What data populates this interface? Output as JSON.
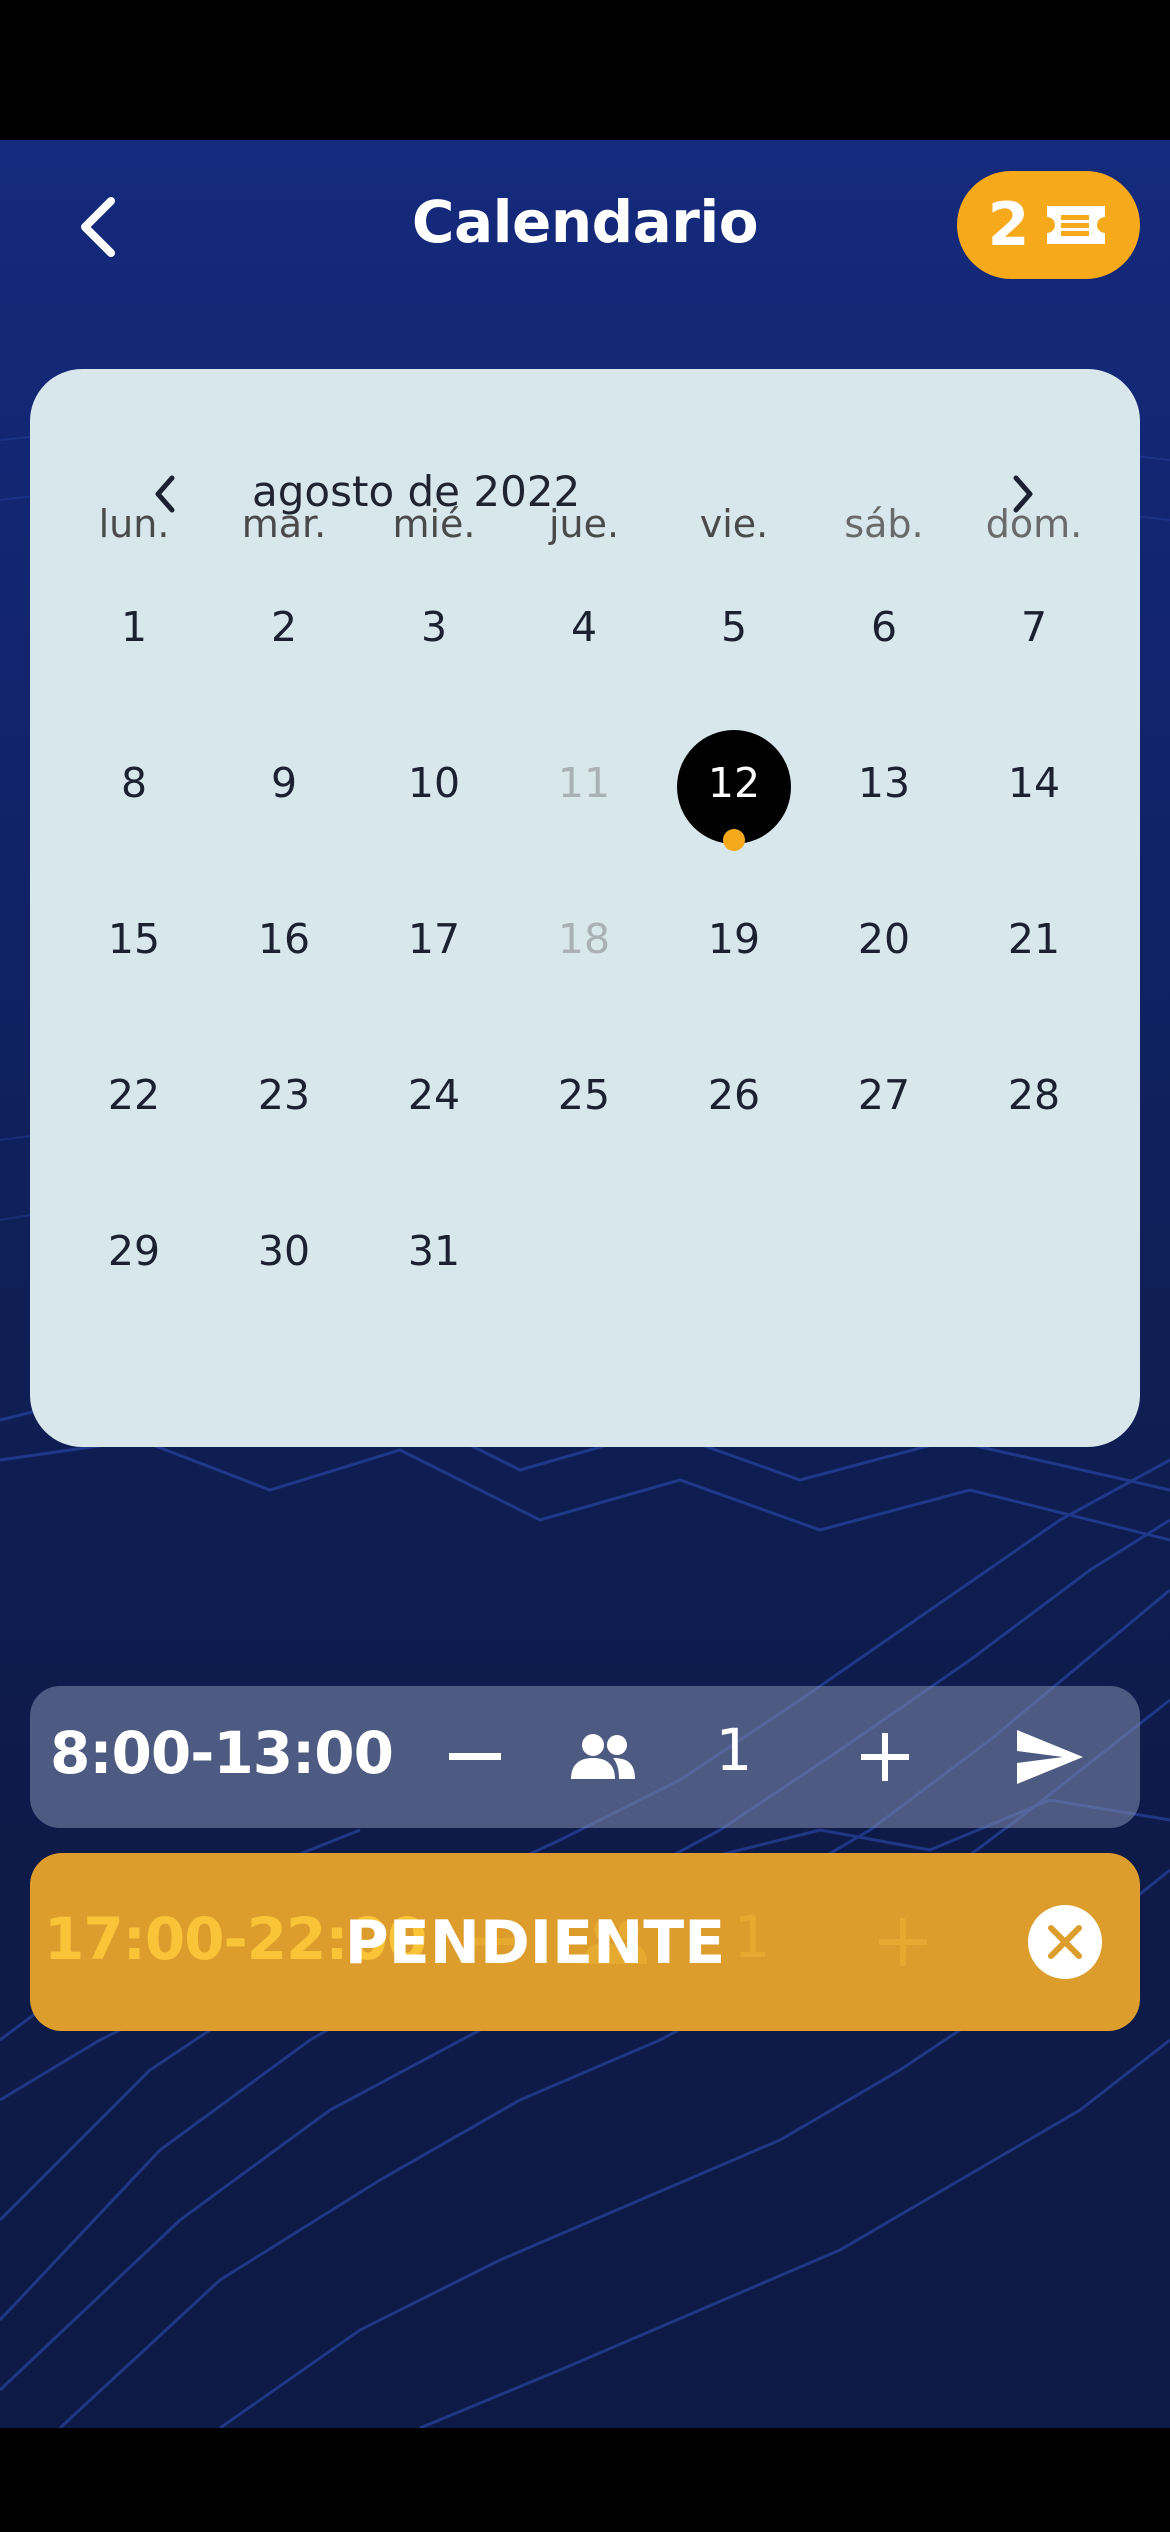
{
  "header": {
    "title": "Calendario",
    "tickets_count": "2"
  },
  "calendar": {
    "month_label": "agosto de 2022",
    "weekdays": [
      "lun.",
      "mar.",
      "mié.",
      "jue.",
      "vie.",
      "sáb.",
      "dom."
    ],
    "days": [
      [
        "1",
        "2",
        "3",
        "4",
        "5",
        "6",
        "7"
      ],
      [
        "8",
        "9",
        "10",
        "11",
        "12",
        "13",
        "14"
      ],
      [
        "15",
        "16",
        "17",
        "18",
        "19",
        "20",
        "21"
      ],
      [
        "22",
        "23",
        "24",
        "25",
        "26",
        "27",
        "28"
      ],
      [
        "29",
        "30",
        "31",
        "",
        "",
        "",
        ""
      ]
    ],
    "disabled_days": [
      "11",
      "18"
    ],
    "selected_day": "12",
    "marked_days": [
      "12"
    ]
  },
  "slots": [
    {
      "time": "8:00-13:00",
      "count": "1",
      "status": ""
    },
    {
      "time": "17:00-22:00",
      "count": "1",
      "status": "PENDIENTE"
    }
  ],
  "colors": {
    "accent": "#f7a91c",
    "background": "#11236a",
    "calendar_bg": "#d8e7ec",
    "pending_bg": "#dc9d2d"
  }
}
